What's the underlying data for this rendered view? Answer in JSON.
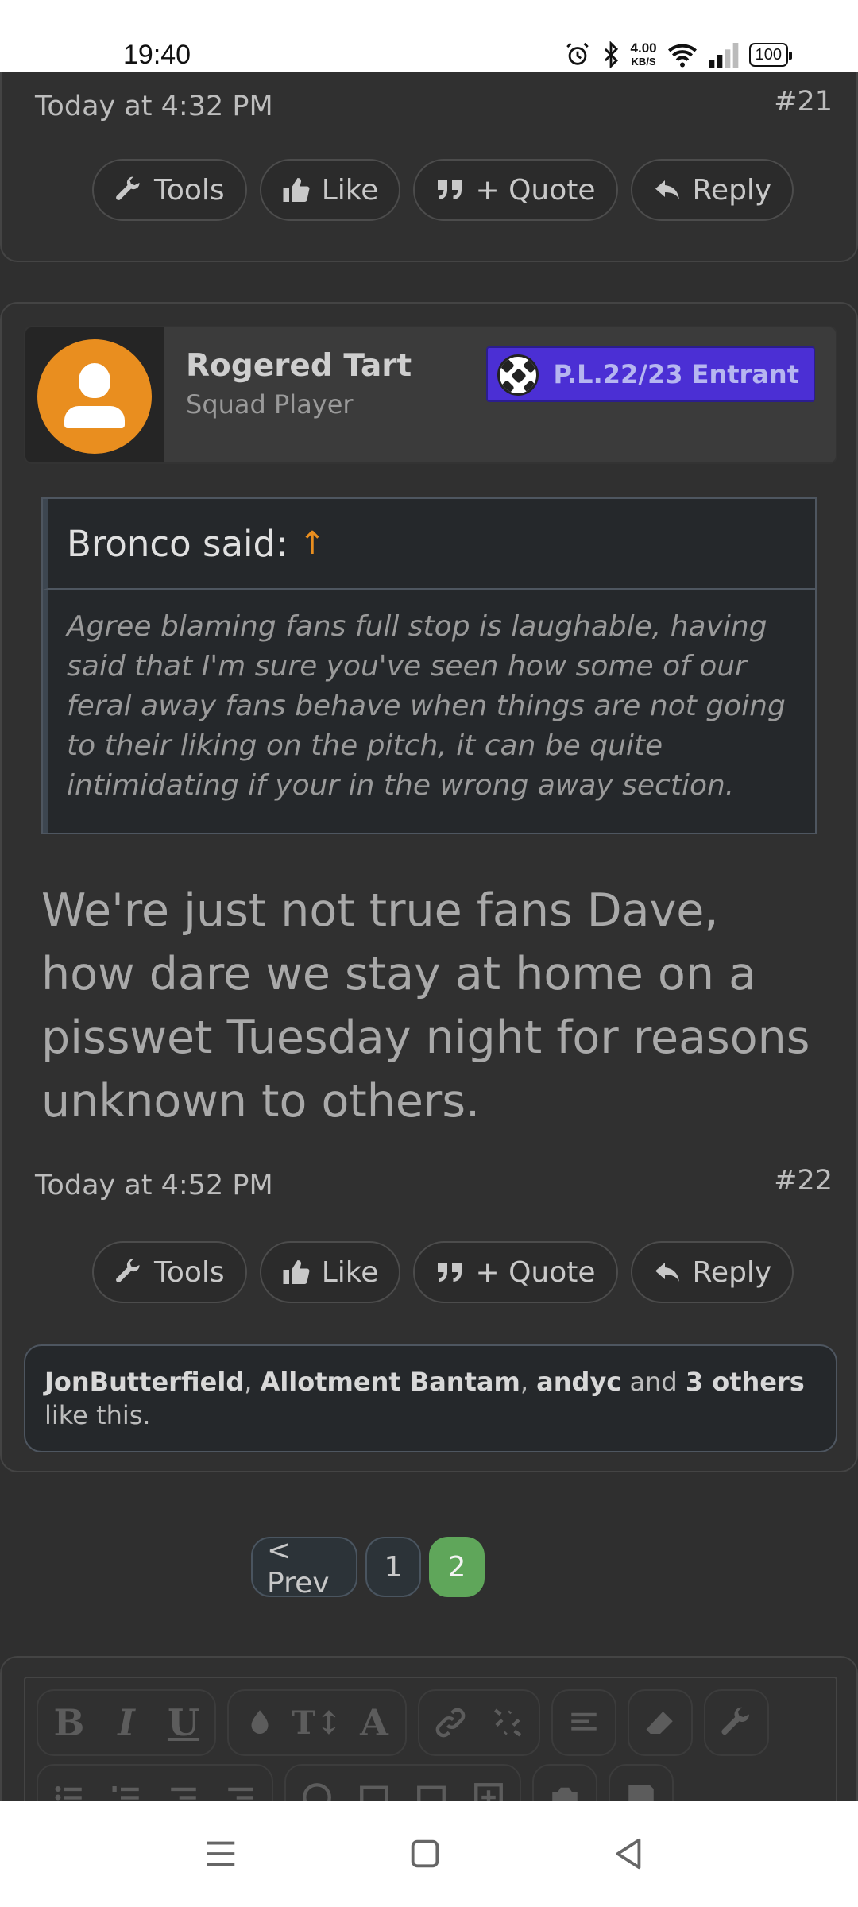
{
  "status_bar": {
    "time": "19:40",
    "net_speed": "4.00",
    "net_unit": "KB/S",
    "battery": "100",
    "icons": [
      "alarm-icon",
      "bluetooth-icon",
      "wifi-icon",
      "signal-icon",
      "battery-icon"
    ]
  },
  "post_21": {
    "date": "Today at 4:32 PM",
    "number": "#21"
  },
  "actions": {
    "tools": "Tools",
    "like": "Like",
    "quote": "+ Quote",
    "reply": "Reply"
  },
  "post_22": {
    "user": {
      "name": "Rogered Tart",
      "title": "Squad Player",
      "banner": "P.L.22/23 Entrant",
      "banner_color": "#4b2fd4",
      "avatar_color": "#e98e1f"
    },
    "quote": {
      "author": "Bronco said:",
      "arrow": "↑",
      "text": "Agree blaming fans full stop is laughable, having said that I'm sure you've seen how some of our feral away fans behave when things are not going to their liking on the pitch, it can be quite intimidating if your in the wrong away section."
    },
    "text": "We're just not true fans Dave, how dare we stay at home on a pisswet Tuesday night for reasons unknown to others.",
    "date": "Today at 4:52 PM",
    "number": "#22",
    "likes": {
      "user1": "JonButterfield",
      "sep1": ", ",
      "user2": "Allotment Bantam",
      "sep2": ", ",
      "user3": "andyc",
      "and": " and ",
      "others": "3 others",
      "suffix": " like this."
    }
  },
  "pagination": {
    "prev": "< Prev",
    "pages": [
      "1",
      "2"
    ],
    "current": "2",
    "active_color": "#5fa65a"
  },
  "editor": {
    "bold": "B",
    "italic": "I",
    "underline": "U",
    "font_size": "T↕",
    "font_family": "A"
  }
}
